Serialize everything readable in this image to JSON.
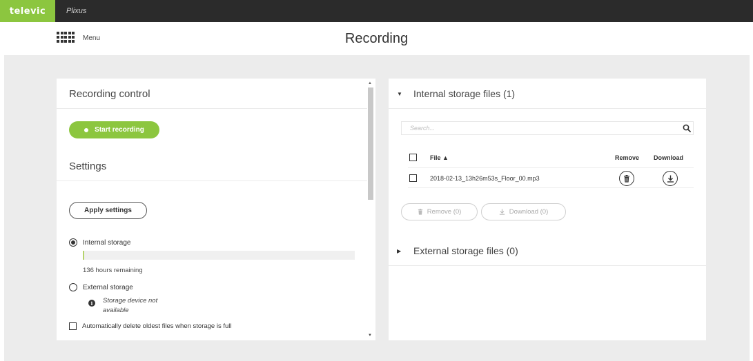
{
  "brand": {
    "logo": "televic",
    "app_name": "Plixus",
    "accent_color": "#8cc63f"
  },
  "header": {
    "menu_label": "Menu",
    "title": "Recording"
  },
  "recording_control": {
    "title": "Recording control",
    "start_label": "Start recording"
  },
  "settings": {
    "title": "Settings",
    "apply_label": "Apply settings",
    "internal_label": "Internal storage",
    "internal_selected": true,
    "internal_used_fraction": 0.005,
    "hours_remaining": "136 hours remaining",
    "external_label": "External storage",
    "external_note": "Storage device not available",
    "auto_delete_label": "Automatically delete oldest files when storage is full",
    "auto_delete_checked": false
  },
  "internal_files": {
    "title": "Internal storage files (1)",
    "search_placeholder": "Search...",
    "columns": {
      "file": "File ▲",
      "remove": "Remove",
      "download": "Download"
    },
    "rows": [
      {
        "file": "2018-02-13_13h26m53s_Floor_00.mp3"
      }
    ],
    "remove_all_label": "Remove (0)",
    "download_all_label": "Download (0)"
  },
  "external_files": {
    "title": "External storage files (0)"
  },
  "icons": {
    "menu": "grid-icon",
    "search": "search-icon",
    "remove": "trash-icon",
    "download": "download-icon",
    "info": "info-icon",
    "expanded": "triangle-down-icon",
    "collapsed": "triangle-right-icon"
  }
}
